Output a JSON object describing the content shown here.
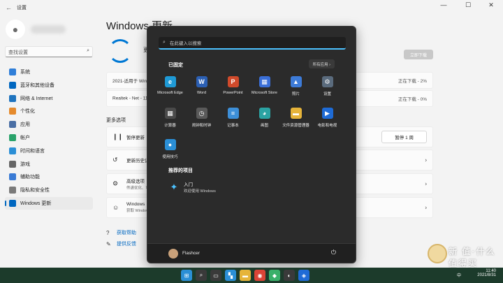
{
  "window": {
    "title": "设置",
    "app_icon": "back-arrow-icon",
    "controls": [
      "—",
      "☐",
      "✕"
    ]
  },
  "user": {
    "avatar": "person-icon"
  },
  "search": {
    "placeholder": "查找设置",
    "icon": "search-icon"
  },
  "nav": {
    "items": [
      {
        "label": "系统",
        "icon": "monitor-icon",
        "color": "#2f7ed8"
      },
      {
        "label": "蓝牙和其他设备",
        "icon": "bluetooth-icon",
        "color": "#0067c0"
      },
      {
        "label": "网络 & Internet",
        "icon": "network-icon",
        "color": "#1e73be"
      },
      {
        "label": "个性化",
        "icon": "brush-icon",
        "color": "#e58a2c"
      },
      {
        "label": "应用",
        "icon": "apps-icon",
        "color": "#4a6fa5"
      },
      {
        "label": "帐户",
        "icon": "account-icon",
        "color": "#2aa36b"
      },
      {
        "label": "时间和语言",
        "icon": "globe-icon",
        "color": "#2b8fd6"
      },
      {
        "label": "游戏",
        "icon": "game-icon",
        "color": "#666666"
      },
      {
        "label": "辅助功能",
        "icon": "accessibility-icon",
        "color": "#3a7bd5"
      },
      {
        "label": "隐私和安全性",
        "icon": "shield-icon",
        "color": "#7a7a7a"
      },
      {
        "label": "Windows 更新",
        "icon": "update-icon",
        "color": "#0067c0"
      }
    ],
    "active_index": 10
  },
  "main": {
    "title": "Windows 更新",
    "sync_label": "更",
    "download_now": "立即下载",
    "updates": [
      {
        "name": "2021-适用于 Win",
        "status": "正在下载 - 2%"
      },
      {
        "name": "Realtek - Net - 11",
        "status": "正在下载 - 0%"
      }
    ],
    "more_options_label": "更多选项",
    "options": [
      {
        "title": "暂停更新",
        "icon": "pause-icon",
        "action": "暂停 1 周"
      },
      {
        "title": "更新历史记",
        "icon": "history-icon",
        "chevron": "›"
      },
      {
        "title": "高级选项",
        "sub": "传递优化、可",
        "icon": "gear-icon",
        "chevron": "›"
      },
      {
        "title": "Windows",
        "sub": "获取 Window",
        "icon": "insider-icon",
        "chevron": "›"
      }
    ],
    "links": [
      {
        "label": "获取帮助",
        "icon": "help-icon"
      },
      {
        "label": "提供反馈",
        "icon": "feedback-icon"
      }
    ]
  },
  "start_menu": {
    "search_placeholder": "在此键入以搜索",
    "pinned_label": "已固定",
    "all_apps_label": "所有应用 ›",
    "apps": [
      {
        "name": "Microsoft Edge",
        "icon": "edge-icon",
        "color": "#1f9ad6",
        "glyph": "e"
      },
      {
        "name": "Word",
        "icon": "word-icon",
        "color": "#2b5fb3",
        "glyph": "W"
      },
      {
        "name": "PowerPoint",
        "icon": "powerpoint-icon",
        "color": "#d04a2b",
        "glyph": "P"
      },
      {
        "name": "Microsoft Store",
        "icon": "store-icon",
        "color": "#3a6fd8",
        "glyph": "▦"
      },
      {
        "name": "照片",
        "icon": "photos-icon",
        "color": "#3d7bd8",
        "glyph": "▲"
      },
      {
        "name": "设置",
        "icon": "settings-icon",
        "color": "#5a6b7d",
        "glyph": "⚙"
      },
      {
        "name": "计算器",
        "icon": "calculator-icon",
        "color": "#4a4a4a",
        "glyph": "▦"
      },
      {
        "name": "闹钟和时钟",
        "icon": "clock-icon",
        "color": "#5a5a5a",
        "glyph": "◷"
      },
      {
        "name": "记事本",
        "icon": "notepad-icon",
        "color": "#3d8fd8",
        "glyph": "≡"
      },
      {
        "name": "画图",
        "icon": "paint-icon",
        "color": "#2ba3a3",
        "glyph": "◕"
      },
      {
        "name": "文件资源管理器",
        "icon": "folder-icon",
        "color": "#e6b43a",
        "glyph": "▬"
      },
      {
        "name": "电影和电视",
        "icon": "movies-icon",
        "color": "#1e6bd6",
        "glyph": "▶"
      },
      {
        "name": "使用技巧",
        "icon": "tips-icon",
        "color": "#2b8fd6",
        "glyph": "●"
      }
    ],
    "recommended_label": "推荐的项目",
    "recommended": [
      {
        "title": "入门",
        "sub": "欢迎使用 Windows",
        "icon": "getstarted-icon"
      }
    ],
    "user_name": "Flashcer",
    "power_icon": "power-icon"
  },
  "taskbar": {
    "icons": [
      {
        "name": "start-icon",
        "color": "#2b8fd6",
        "glyph": "⊞"
      },
      {
        "name": "search-task-icon",
        "color": "#3a3a3a",
        "glyph": "⌕"
      },
      {
        "name": "taskview-icon",
        "color": "#3a3a3a",
        "glyph": "▭"
      },
      {
        "name": "widgets-icon",
        "color": "#2b8fd6",
        "glyph": "▚"
      },
      {
        "name": "explorer-icon",
        "color": "#e6b43a",
        "glyph": "▬"
      },
      {
        "name": "chrome-icon",
        "color": "#db4437",
        "glyph": "◉"
      },
      {
        "name": "app-icon",
        "color": "#3ab06a",
        "glyph": "◆"
      },
      {
        "name": "qq-icon",
        "color": "#3a3a3a",
        "glyph": "◐"
      },
      {
        "name": "network-task-icon",
        "color": "#1f6bd6",
        "glyph": "◈"
      }
    ],
    "tray": "中",
    "time": "11:40",
    "date": "2021/8/31"
  },
  "watermark": {
    "text": "新 值·什么值得买"
  }
}
